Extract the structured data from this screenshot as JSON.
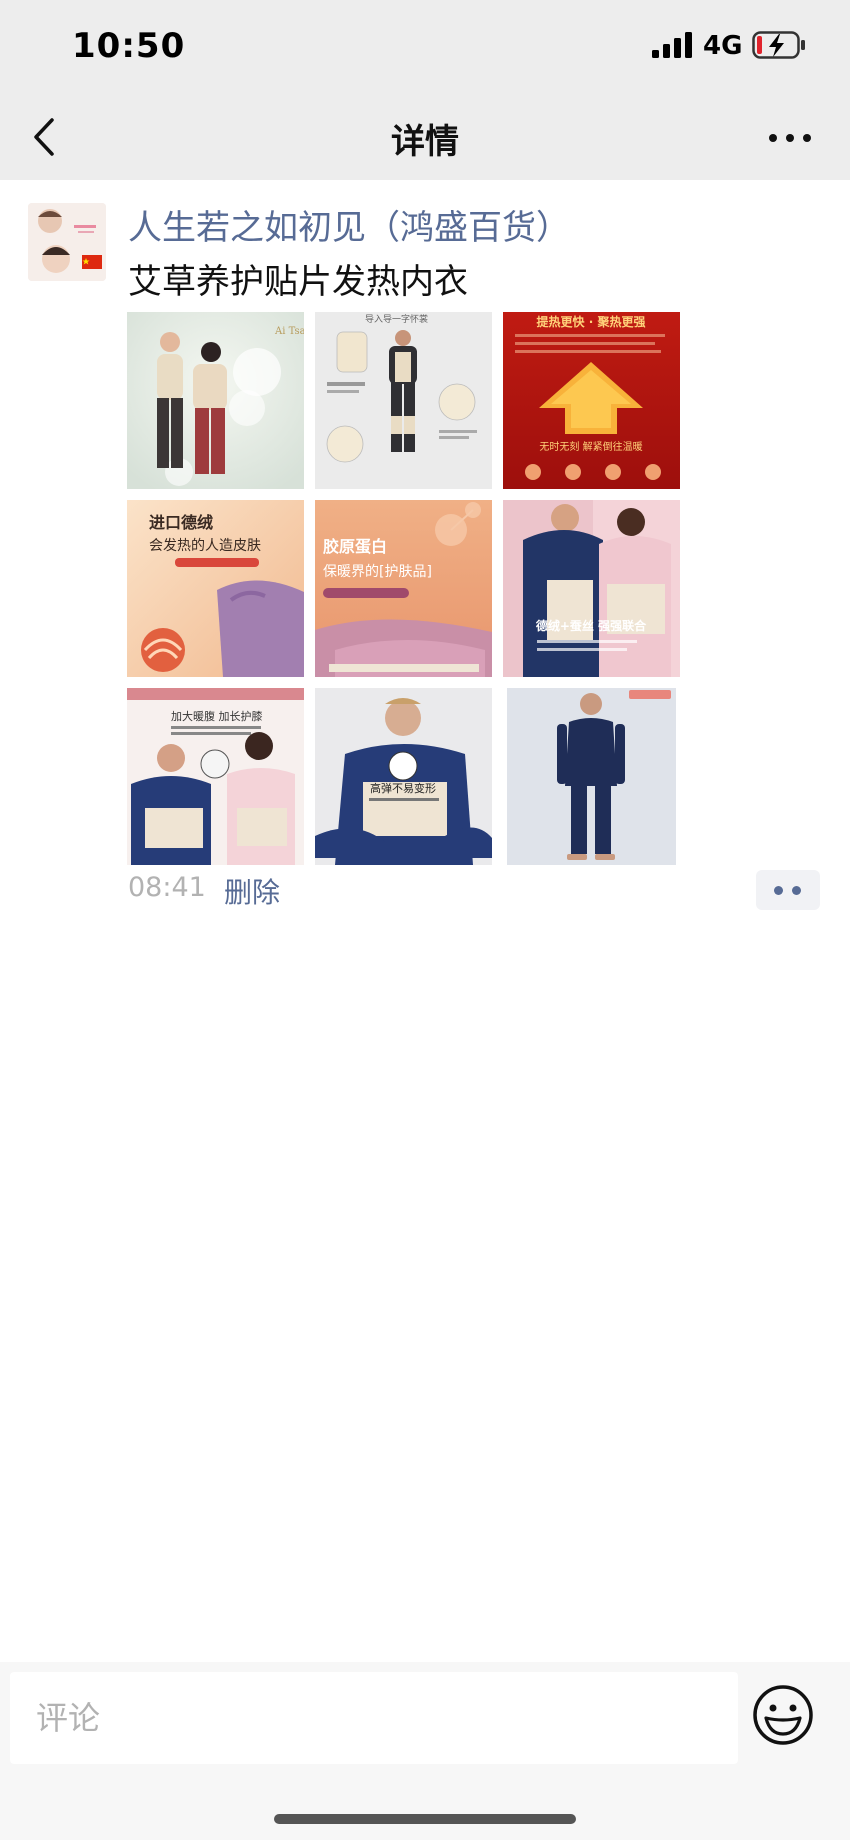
{
  "status_bar": {
    "time": "10:50",
    "network": "4G",
    "battery_icon": "battery-charging-low-icon",
    "signal_icon": "cellular-signal-icon"
  },
  "nav": {
    "title": "详情",
    "back_icon": "chevron-left-icon",
    "more_icon": "more-dots-icon"
  },
  "post": {
    "author": "人生若之如初见（鸿盛百货）",
    "text": "艾草养护贴片发热内衣",
    "time": "08:41",
    "delete_label": "删除",
    "action_icon": "two-dots-icon",
    "photos": [
      {
        "caption": "",
        "texts": [
          "Ai Tsao"
        ]
      },
      {
        "caption": "",
        "texts": [
          "导入导一字怀裳"
        ]
      },
      {
        "caption": "",
        "texts": [
          "提热更快 · 聚热更强",
          "无时无刻 解紧倒往温暖"
        ]
      },
      {
        "caption": "",
        "texts": [
          "进口德绒",
          "会发热的人造皮肤"
        ]
      },
      {
        "caption": "",
        "texts": [
          "胶原蛋白",
          "保暖界的[护肤品]"
        ]
      },
      {
        "caption": "",
        "texts": [
          "德绒+蚕丝 强强联合"
        ]
      },
      {
        "caption": "",
        "texts": [
          "加大暖腹 加长护膝"
        ]
      },
      {
        "caption": "",
        "texts": [
          "高弹不易变形"
        ]
      },
      {
        "caption": "",
        "texts": []
      }
    ]
  },
  "comment": {
    "placeholder": "评论",
    "emoji_icon": "smiley-face-icon"
  },
  "colors": {
    "link": "#576b95",
    "top_bar_bg": "#ededed",
    "muted_text": "#b2b2b2"
  }
}
